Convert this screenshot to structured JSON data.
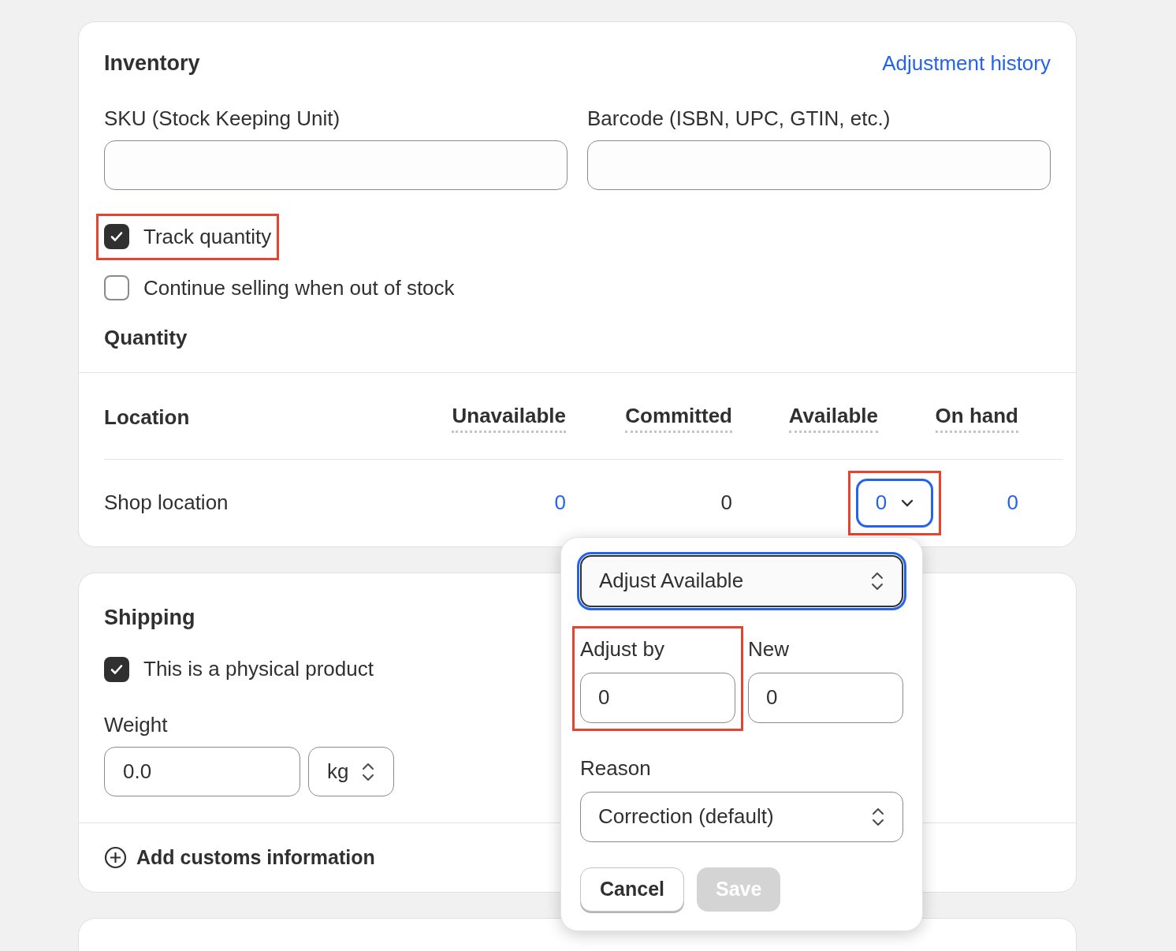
{
  "inventory": {
    "title": "Inventory",
    "history_link": "Adjustment history",
    "fields": [
      {
        "label": "SKU (Stock Keeping Unit)"
      },
      {
        "label": "Barcode (ISBN, UPC, GTIN, etc.)"
      }
    ],
    "checkboxes": [
      {
        "label": "Track quantity",
        "checked": true,
        "highlighted": true
      },
      {
        "label": "Continue selling when out of stock",
        "checked": false,
        "highlighted": false
      }
    ],
    "quantity_title": "Quantity",
    "table": {
      "columns": [
        "Location",
        "Unavailable",
        "Committed",
        "Available",
        "On hand"
      ],
      "rows": [
        {
          "cells": [
            {
              "kind": "text",
              "text": "Shop location"
            },
            {
              "kind": "link",
              "text": "0"
            },
            {
              "kind": "text",
              "text": "0"
            },
            {
              "kind": "dropdown",
              "text": "0",
              "expanded": true,
              "highlighted": true
            },
            {
              "kind": "link",
              "text": "0"
            }
          ]
        }
      ]
    }
  },
  "popover": {
    "select": "Adjust Available",
    "adjust_by": {
      "label": "Adjust by",
      "value": "0",
      "highlighted": true
    },
    "new": {
      "label": "New",
      "value": "0"
    },
    "reason": {
      "label": "Reason",
      "value": "Correction (default)"
    },
    "buttons": [
      {
        "label": "Cancel",
        "disabled": false
      },
      {
        "label": "Save",
        "disabled": true
      }
    ]
  },
  "shipping": {
    "title": "Shipping",
    "checkbox": {
      "label": "This is a physical product",
      "checked": true
    },
    "weight_label": "Weight",
    "weight_value": "0.0",
    "unit": "kg",
    "customs": "Add customs information"
  }
}
